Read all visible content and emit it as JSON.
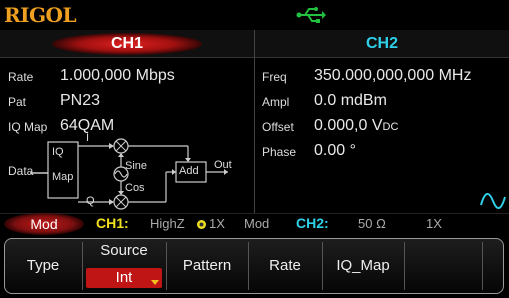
{
  "header": {
    "logo": "RIGOL",
    "usb_icon": "usb-icon"
  },
  "tabs": {
    "ch1": "CH1",
    "ch2": "CH2"
  },
  "ch1": {
    "params": [
      {
        "name": "Rate",
        "value": "1.000,000 Mbps"
      },
      {
        "name": "Pat",
        "value": "PN23"
      },
      {
        "name": "IQ Map",
        "value": "64QAM"
      }
    ],
    "diagram": {
      "data_label": "Data",
      "iq_map_line1": "IQ",
      "iq_map_line2": "Map",
      "i_label": "I",
      "q_label": "Q",
      "sine_label": "Sine",
      "cos_label": "Cos",
      "add_label": "Add",
      "out_label": "Out"
    }
  },
  "ch2": {
    "params": [
      {
        "name": "Freq",
        "value": "350.000,000,000 MHz"
      },
      {
        "name": "Ampl",
        "value": "0.0 mdBm"
      },
      {
        "name": "Offset",
        "value": "0.000,0 V",
        "sub": "DC"
      },
      {
        "name": "Phase",
        "value": "0.00 °"
      }
    ],
    "wave_icon": "sine-wave-icon"
  },
  "status": {
    "mode": "Mod",
    "ch1_label": "CH1:",
    "ch1_imp": "HighZ",
    "ch1_probe": "1X",
    "ch1_mod": "Mod",
    "ch2_label": "CH2:",
    "ch2_imp": "50 Ω",
    "ch2_probe": "1X"
  },
  "softkeys": {
    "type": "Type",
    "source_title": "Source",
    "source_value": "Int",
    "pattern": "Pattern",
    "rate": "Rate",
    "iq_map": "IQ_Map"
  },
  "colors": {
    "accent_red": "#c01515",
    "ch2_cyan": "#2fd0e8",
    "ch1_yellow": "#f0e020",
    "logo_orange": "#f0a020",
    "usb_green": "#22c040"
  }
}
